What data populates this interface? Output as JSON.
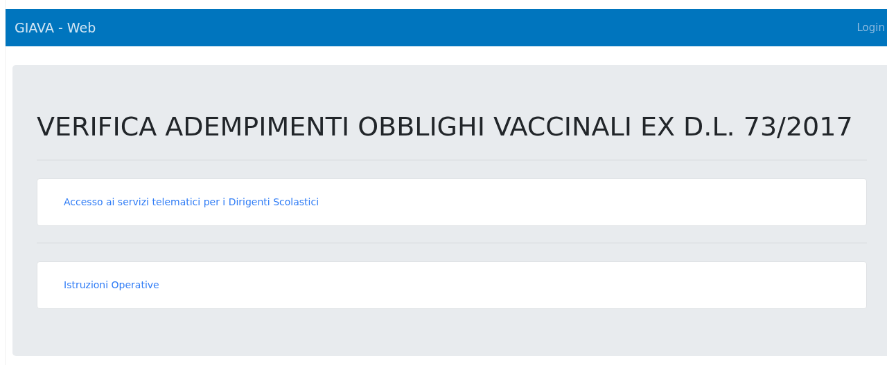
{
  "navbar": {
    "brand": "GIAVA - Web",
    "login": "Login"
  },
  "heading": "VERIFICA ADEMPIMENTI OBBLIGHI VACCINALI EX D.L. 73/2017",
  "links": [
    {
      "label": "Accesso ai servizi telematici per i Dirigenti Scolastici"
    },
    {
      "label": "Istruzioni Operative"
    }
  ]
}
